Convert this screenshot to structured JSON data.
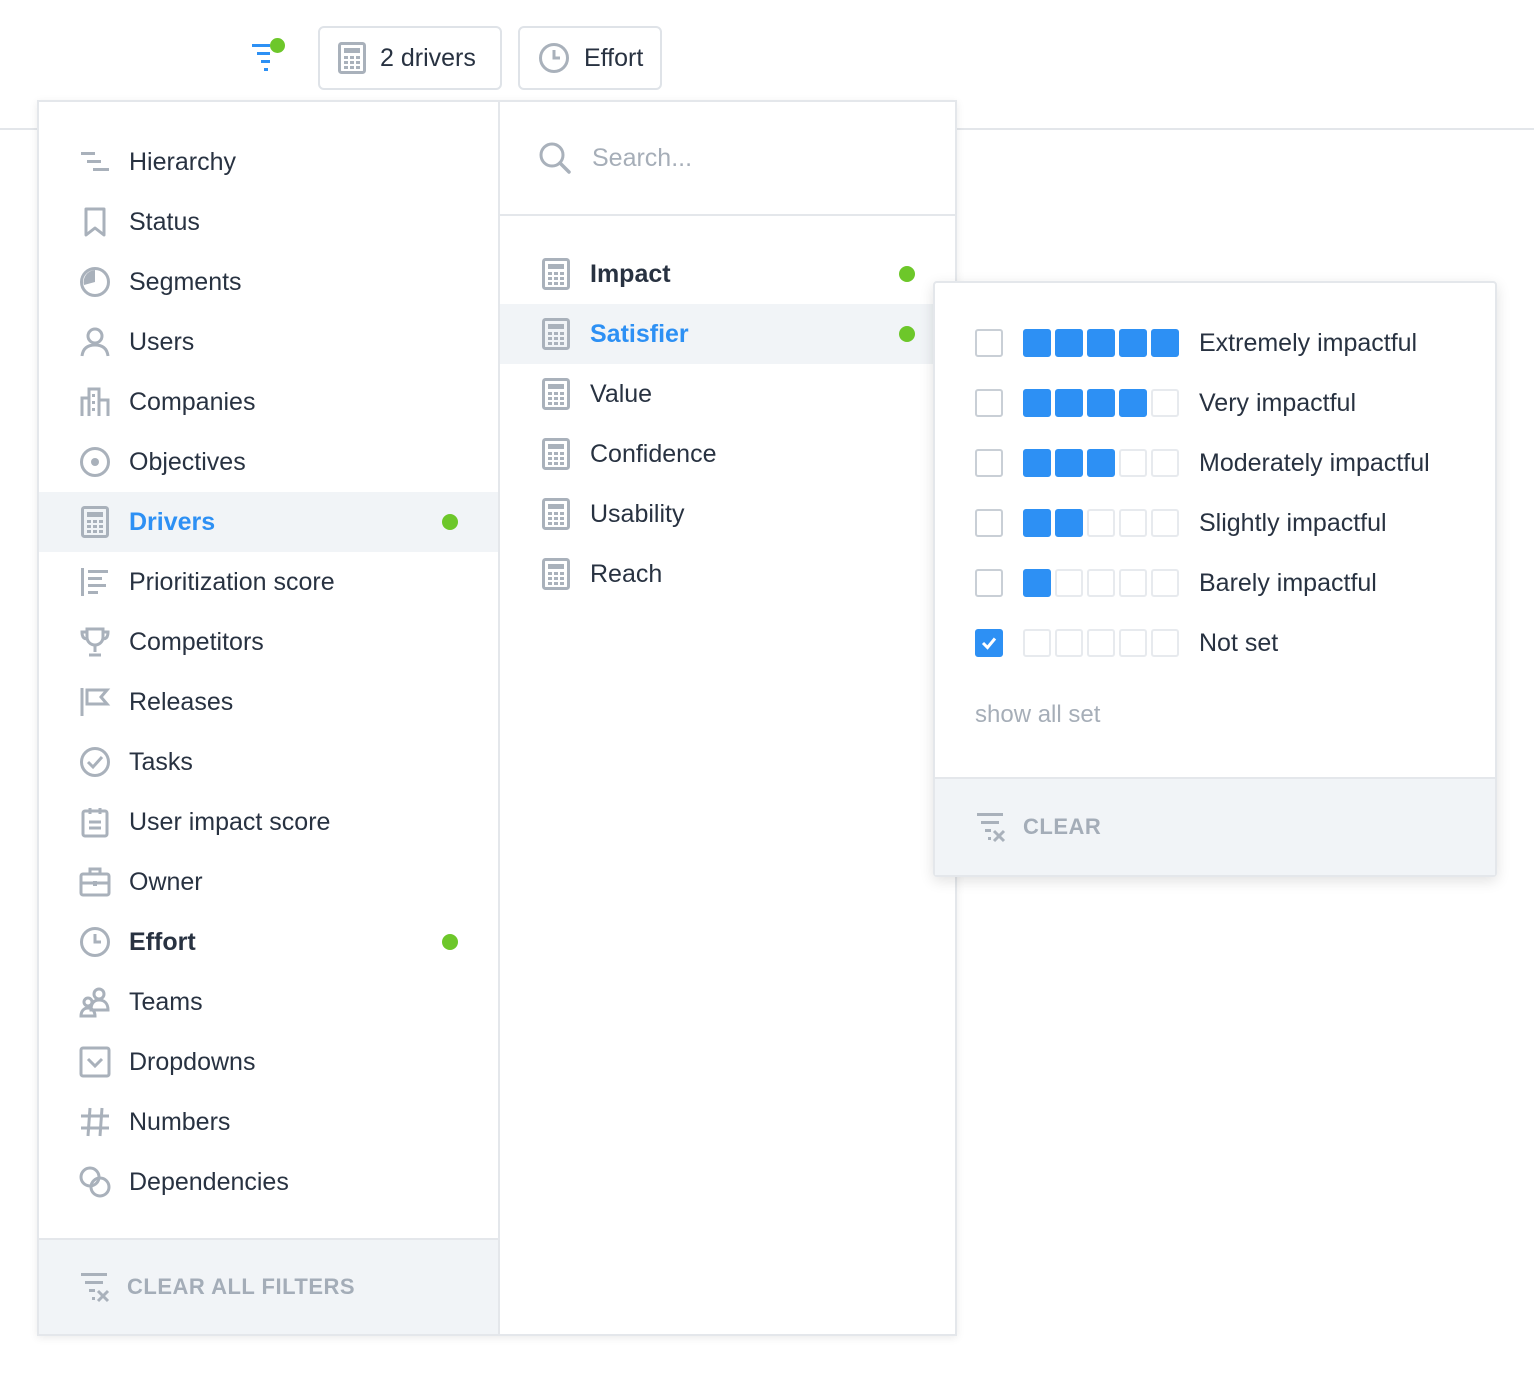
{
  "toolbar": {
    "filter_icon": "filter-icon",
    "chips": [
      {
        "label": "2 drivers",
        "icon": "calculator-icon"
      },
      {
        "label": "Effort",
        "icon": "clock-icon"
      }
    ]
  },
  "categories": {
    "items": [
      {
        "label": "Hierarchy",
        "icon": "hierarchy-icon"
      },
      {
        "label": "Status",
        "icon": "bookmark-icon"
      },
      {
        "label": "Segments",
        "icon": "pie-icon"
      },
      {
        "label": "Users",
        "icon": "user-icon"
      },
      {
        "label": "Companies",
        "icon": "building-icon"
      },
      {
        "label": "Objectives",
        "icon": "target-icon"
      },
      {
        "label": "Drivers",
        "icon": "calculator-icon",
        "active": true,
        "dot": true
      },
      {
        "label": "Prioritization score",
        "icon": "score-list-icon"
      },
      {
        "label": "Competitors",
        "icon": "trophy-icon"
      },
      {
        "label": "Releases",
        "icon": "flag-icon"
      },
      {
        "label": "Tasks",
        "icon": "check-circle-icon"
      },
      {
        "label": "User impact score",
        "icon": "clipboard-icon"
      },
      {
        "label": "Owner",
        "icon": "briefcase-icon"
      },
      {
        "label": "Effort",
        "icon": "clock-icon",
        "bold": true,
        "dot": true
      },
      {
        "label": "Teams",
        "icon": "teams-icon"
      },
      {
        "label": "Dropdowns",
        "icon": "dropdown-icon"
      },
      {
        "label": "Numbers",
        "icon": "hash-icon"
      },
      {
        "label": "Dependencies",
        "icon": "link-icon"
      }
    ],
    "clear_all_label": "CLEAR ALL FILTERS"
  },
  "drivers": {
    "search_placeholder": "Search...",
    "items": [
      {
        "label": "Impact",
        "bold": true,
        "dot": true
      },
      {
        "label": "Satisfier",
        "active": true,
        "dot": true
      },
      {
        "label": "Value"
      },
      {
        "label": "Confidence"
      },
      {
        "label": "Usability"
      },
      {
        "label": "Reach"
      }
    ]
  },
  "impact_options": {
    "options": [
      {
        "label": "Extremely impactful",
        "level": 5,
        "checked": false
      },
      {
        "label": "Very impactful",
        "level": 4,
        "checked": false
      },
      {
        "label": "Moderately impactful",
        "level": 3,
        "checked": false
      },
      {
        "label": "Slightly impactful",
        "level": 2,
        "checked": false
      },
      {
        "label": "Barely impactful",
        "level": 1,
        "checked": false
      },
      {
        "label": "Not set",
        "level": 0,
        "checked": true
      }
    ],
    "max_level": 5,
    "show_all_label": "show all set",
    "clear_label": "CLEAR"
  },
  "colors": {
    "accent": "#2d90f4",
    "active_dot": "#6dc72a",
    "icon_gray": "#a9b1bb",
    "muted_text": "#a6aeb8"
  }
}
